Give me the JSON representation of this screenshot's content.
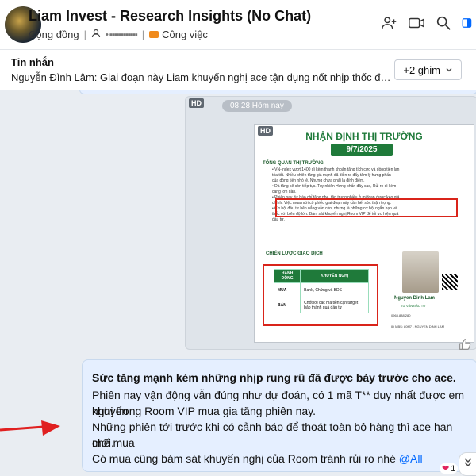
{
  "header": {
    "title": "Liam Invest - Research  Insights (No Chat)",
    "community": "Cộng đồng",
    "members_masked": "•  ▪▪▪▪▪▪▪▪▪▪▪▪",
    "category": "Công việc"
  },
  "pinned": {
    "title": "Tin nhắn",
    "text": "Nguyễn Đình Lâm: Giai đoạn này Liam khuyến nghị ace tận dụng nốt nhịp thốc để gom lợi n...",
    "more_button": "+2 ghim"
  },
  "image_message": {
    "badge": "HD",
    "time": "08:28 Hôm nay",
    "inner_badge": "HD",
    "report": {
      "title": "NHẬN ĐỊNH THỊ TRƯỜNG",
      "date": "9/7/2025",
      "section1": "TỔNG QUAN THỊ TRƯỜNG",
      "section1_lines": [
        "• VN-Index vượt 1400 đi kèm thanh khoản tăng tích cực và dòng tiền lan",
        "  tỏa tốt. Nhiều phiên tăng giá mạnh đã diễn ra đẩy tâm lý hưng phấn",
        "  của dòng tiền nhỏ lẻ. Nhưng chưa phải là đỉnh điểm.",
        "• Đà tăng sẽ còn tiếp tục. Tuy nhiên Hưng phấn đây cao, Rủi ro đi kèm",
        "  càng lớn dần.",
        "• Phiên nay dự báo chỉ tăng nhẹ, tập trung nhiều ở midcap được kéo giá",
        "  chính. Việc mua mới cổ phiếu giai đoạn này cần hết sức thận trọng.",
        "• Cơ hội đầu tư bên nắng vẫn còn, nhưng là những cơ hội ngắn hạn và",
        "  thốc với biên độ lớn. Bám sát khuyến nghị Room VIP để tối ưu hiệu quả",
        "  đầu tư."
      ],
      "section2": "CHIẾN LƯỢC GIAO DỊCH",
      "table_headers": [
        "HÀNH ĐỘNG",
        "KHUYẾN NGHỊ"
      ],
      "table_rows": [
        [
          "MUA",
          "Bank, Chứng và BĐS"
        ],
        [
          "BÁN",
          "Chốt lời các mã tiền cận target bảo thành quả đầu tư"
        ]
      ],
      "name": "Nguyen Dinh Lam",
      "role": "TƯ VẤN ĐẦU TƯ",
      "phone": "0963.888.280",
      "id_line": "ID MBS: 80M7 - NGUYEN DINH LAM"
    }
  },
  "text_message": {
    "line1": "Sức tăng mạnh kèm những nhịp rung rũ đã được bày trước cho ace.",
    "line2": "Phiên nay vận động vẫn đúng như dự đoán, có 1 mã T** duy nhất được em khuyến",
    "line3": "nghị trong Room VIP mua gia tăng phiên nay.",
    "line4": "Những phiên tới trước khi có cảnh báo để thoát toàn bộ hàng thì ace hạn chế mua",
    "line5": "mới.",
    "line6": "Có mua cũng bám sát khuyến nghị của Room tránh rủi ro nhé",
    "mention": "@All",
    "reaction_count": "1"
  },
  "colors": {
    "accent": "#0068ff",
    "bubble": "#e5efff",
    "arrow": "#e02020",
    "report_green": "#1f7a3a"
  }
}
